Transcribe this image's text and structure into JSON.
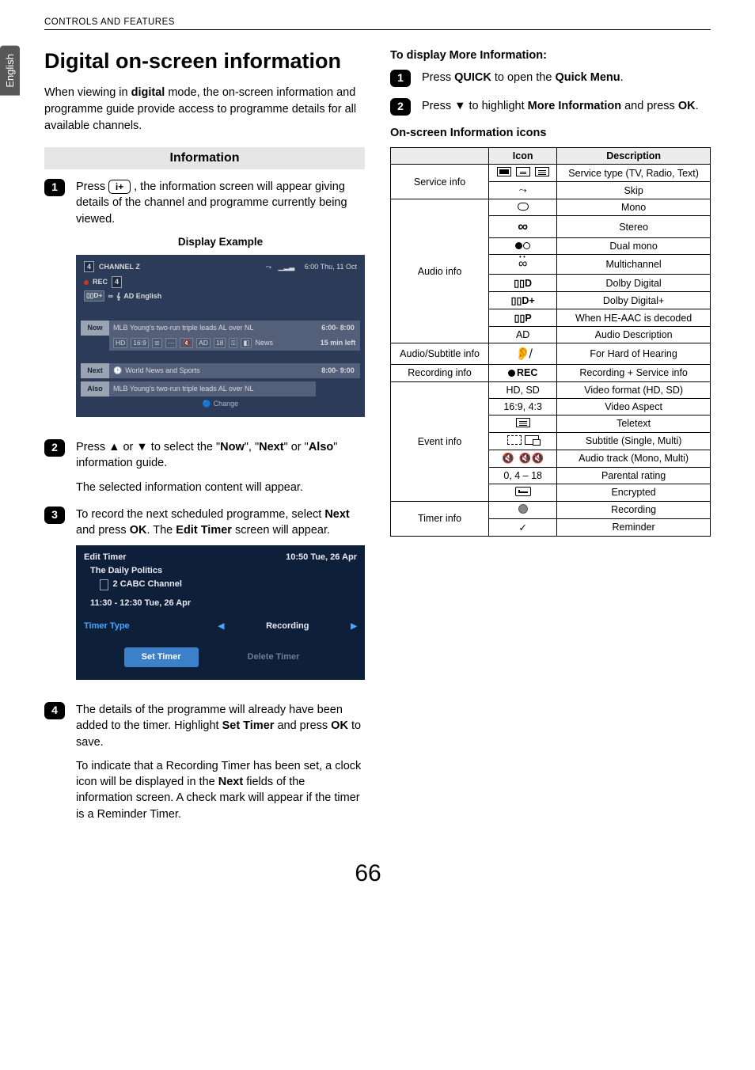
{
  "side_tab": "English",
  "header": "CONTROLS AND FEATURES",
  "title": "Digital on-screen information",
  "intro_pre": "When viewing in ",
  "intro_bold": "digital",
  "intro_post": " mode, the on-screen information and programme guide provide access to programme details for all available channels.",
  "section_info": "Information",
  "left": {
    "s1_a": "Press ",
    "s1_b": ", the information screen will appear giving details of the channel and programme currently being viewed.",
    "info_btn": "i+",
    "display_caption": "Display Example",
    "s2_a": "Press ",
    "s2_b": " or ",
    "s2_c": " to select the \"",
    "s2_now": "Now",
    "s2_d": "\", \"",
    "s2_next": "Next",
    "s2_e": "\" or \"",
    "s2_also": "Also",
    "s2_f": "\" information guide.",
    "s2_p2": "The selected information content will appear.",
    "s3_a": "To record the next scheduled programme, select ",
    "s3_next": "Next",
    "s3_b": " and press ",
    "s3_ok": "OK",
    "s3_c": ". The ",
    "s3_et": "Edit Timer",
    "s3_d": " screen will appear.",
    "s4_a": "The details of the programme will already have been added to the timer. Highlight ",
    "s4_set": "Set Timer",
    "s4_b": " and press ",
    "s4_ok": "OK",
    "s4_c": " to save.",
    "s4_p2a": "To indicate that a Recording Timer has been set, a clock icon will be displayed in the ",
    "s4_p2b": "Next",
    "s4_p2c": " fields of the information screen. A check mark will appear if the timer is a Reminder Timer."
  },
  "tv1": {
    "ch_num": "4",
    "ch_name": "CHANNEL Z",
    "clock": "6:00 Thu, 11 Oct",
    "rec": "REC",
    "rec_ch": "4",
    "dd": "D+",
    "ad_lang": "AD English",
    "now_tag": "Now",
    "now_txt": "MLB Young's two-run triple leads AL over NL",
    "now_time": "6:00- 8:00",
    "meta_hd": "HD",
    "meta_ar": "16:9",
    "meta_ad": "AD",
    "meta_pr": "18",
    "meta_cat": "News",
    "meta_left": "15 min left",
    "next_tag": "Next",
    "next_txt": "World News and Sports",
    "next_time": "8:00- 9:00",
    "also_tag": "Also",
    "also_txt": "MLB Young's two-run triple leads AL over NL",
    "change": "Change"
  },
  "tv2": {
    "title": "Edit Timer",
    "clock": "10:50 Tue, 26 Apr",
    "prog": "The Daily Politics",
    "ch": "2 CABC Channel",
    "time": "11:30 - 12:30 Tue, 26 Apr",
    "tt_label": "Timer Type",
    "tt_value": "Recording",
    "btn_set": "Set Timer",
    "btn_del": "Delete Timer"
  },
  "right": {
    "h1": "To display More Information:",
    "s1_a": "Press ",
    "s1_quick": "QUICK",
    "s1_b": " to open the ",
    "s1_qm": "Quick Menu",
    "s1_c": ".",
    "s2_a": "Press ",
    "s2_b": " to highlight ",
    "s2_mi": "More Information",
    "s2_c": " and press ",
    "s2_ok": "OK",
    "s2_d": ".",
    "h2": "On-screen Information icons",
    "th_icon": "Icon",
    "th_desc": "Description",
    "rows": [
      {
        "cat": "Service info",
        "icon": "svc",
        "desc": "Service type (TV, Radio, Text)"
      },
      {
        "cat": "",
        "icon": "skip",
        "desc": "Skip"
      },
      {
        "cat": "Audio info",
        "icon": "mono",
        "desc": "Mono"
      },
      {
        "cat": "",
        "icon": "stereo",
        "desc": "Stereo"
      },
      {
        "cat": "",
        "icon": "dualmono",
        "desc": "Dual mono"
      },
      {
        "cat": "",
        "icon": "multich",
        "desc": "Multichannel"
      },
      {
        "cat": "",
        "icon": "ddD",
        "desc": "Dolby Digital"
      },
      {
        "cat": "",
        "icon": "ddDplus",
        "desc": "Dolby Digital+"
      },
      {
        "cat": "",
        "icon": "ddP",
        "desc": "When HE-AAC is decoded"
      },
      {
        "cat": "",
        "icon": "AD",
        "desc": "Audio Description"
      },
      {
        "cat": "Audio/Subtitle info",
        "icon": "hoh",
        "desc": "For Hard of Hearing"
      },
      {
        "cat": "Recording info",
        "icon": "rec",
        "desc": "Recording + Service info"
      },
      {
        "cat": "Event info",
        "icon": "HDSD",
        "desc": "Video format (HD, SD)"
      },
      {
        "cat": "",
        "icon": "aspect",
        "desc": "Video Aspect"
      },
      {
        "cat": "",
        "icon": "ttx",
        "desc": "Teletext"
      },
      {
        "cat": "",
        "icon": "subtitle",
        "desc": "Subtitle (Single, Multi)"
      },
      {
        "cat": "",
        "icon": "audiotrack",
        "desc": "Audio track (Mono, Multi)"
      },
      {
        "cat": "",
        "icon": "parental",
        "desc": "Parental rating"
      },
      {
        "cat": "",
        "icon": "enc",
        "desc": "Encrypted"
      },
      {
        "cat": "Timer info",
        "icon": "recclock",
        "desc": "Recording"
      },
      {
        "cat": "",
        "icon": "check",
        "desc": "Reminder"
      }
    ],
    "icon_text": {
      "HDSD": "HD, SD",
      "aspect": "16:9, 4:3",
      "AD": "AD",
      "parental": "0, 4 – 18",
      "ddD": "D",
      "ddDplus": "D+",
      "ddP": "P",
      "rec": "REC"
    }
  },
  "page_number": "66"
}
